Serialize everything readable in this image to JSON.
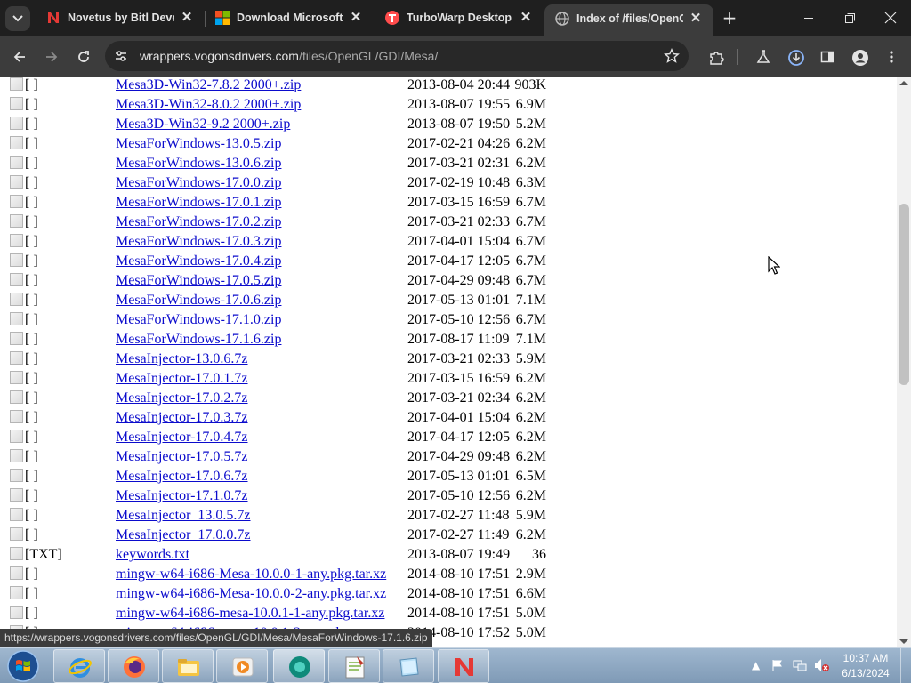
{
  "browser": {
    "tabs": [
      {
        "title": "Novetus by Bitl Developer",
        "favicon": "novetus-n-icon",
        "active": false
      },
      {
        "title": "Download Microsoft Visual C++",
        "favicon": "microsoft-logo-icon",
        "active": false
      },
      {
        "title": "TurboWarp Desktop - Scratch",
        "favicon": "turbowarp-icon",
        "active": false
      },
      {
        "title": "Index of /files/OpenGL/GDI/Mesa",
        "favicon": "globe-icon",
        "active": true
      }
    ],
    "address": {
      "host": "wrappers.vogonsdrivers.com",
      "path": "/files/OpenGL/GDI/Mesa/"
    }
  },
  "listing": {
    "rows": [
      {
        "icon_alt": "[ ]",
        "name": "Mesa3D-Win32-7.8.2 2000+.zip",
        "date": "2013-08-04 20:44",
        "size": "903K"
      },
      {
        "icon_alt": "[ ]",
        "name": "Mesa3D-Win32-8.0.2 2000+.zip",
        "date": "2013-08-07 19:55",
        "size": "6.9M"
      },
      {
        "icon_alt": "[ ]",
        "name": "Mesa3D-Win32-9.2 2000+.zip",
        "date": "2013-08-07 19:50",
        "size": "5.2M"
      },
      {
        "icon_alt": "[ ]",
        "name": "MesaForWindows-13.0.5.zip",
        "date": "2017-02-21 04:26",
        "size": "6.2M"
      },
      {
        "icon_alt": "[ ]",
        "name": "MesaForWindows-13.0.6.zip",
        "date": "2017-03-21 02:31",
        "size": "6.2M"
      },
      {
        "icon_alt": "[ ]",
        "name": "MesaForWindows-17.0.0.zip",
        "date": "2017-02-19 10:48",
        "size": "6.3M"
      },
      {
        "icon_alt": "[ ]",
        "name": "MesaForWindows-17.0.1.zip",
        "date": "2017-03-15 16:59",
        "size": "6.7M"
      },
      {
        "icon_alt": "[ ]",
        "name": "MesaForWindows-17.0.2.zip",
        "date": "2017-03-21 02:33",
        "size": "6.7M"
      },
      {
        "icon_alt": "[ ]",
        "name": "MesaForWindows-17.0.3.zip",
        "date": "2017-04-01 15:04",
        "size": "6.7M"
      },
      {
        "icon_alt": "[ ]",
        "name": "MesaForWindows-17.0.4.zip",
        "date": "2017-04-17 12:05",
        "size": "6.7M"
      },
      {
        "icon_alt": "[ ]",
        "name": "MesaForWindows-17.0.5.zip",
        "date": "2017-04-29 09:48",
        "size": "6.7M"
      },
      {
        "icon_alt": "[ ]",
        "name": "MesaForWindows-17.0.6.zip",
        "date": "2017-05-13 01:01",
        "size": "7.1M"
      },
      {
        "icon_alt": "[ ]",
        "name": "MesaForWindows-17.1.0.zip",
        "date": "2017-05-10 12:56",
        "size": "6.7M"
      },
      {
        "icon_alt": "[ ]",
        "name": "MesaForWindows-17.1.6.zip",
        "date": "2017-08-17 11:09",
        "size": "7.1M"
      },
      {
        "icon_alt": "[ ]",
        "name": "MesaInjector-13.0.6.7z",
        "date": "2017-03-21 02:33",
        "size": "5.9M"
      },
      {
        "icon_alt": "[ ]",
        "name": "MesaInjector-17.0.1.7z",
        "date": "2017-03-15 16:59",
        "size": "6.2M"
      },
      {
        "icon_alt": "[ ]",
        "name": "MesaInjector-17.0.2.7z",
        "date": "2017-03-21 02:34",
        "size": "6.2M"
      },
      {
        "icon_alt": "[ ]",
        "name": "MesaInjector-17.0.3.7z",
        "date": "2017-04-01 15:04",
        "size": "6.2M"
      },
      {
        "icon_alt": "[ ]",
        "name": "MesaInjector-17.0.4.7z",
        "date": "2017-04-17 12:05",
        "size": "6.2M"
      },
      {
        "icon_alt": "[ ]",
        "name": "MesaInjector-17.0.5.7z",
        "date": "2017-04-29 09:48",
        "size": "6.2M"
      },
      {
        "icon_alt": "[ ]",
        "name": "MesaInjector-17.0.6.7z",
        "date": "2017-05-13 01:01",
        "size": "6.5M"
      },
      {
        "icon_alt": "[ ]",
        "name": "MesaInjector-17.1.0.7z",
        "date": "2017-05-10 12:56",
        "size": "6.2M"
      },
      {
        "icon_alt": "[ ]",
        "name": "MesaInjector_13.0.5.7z",
        "date": "2017-02-27 11:48",
        "size": "5.9M"
      },
      {
        "icon_alt": "[ ]",
        "name": "MesaInjector_17.0.0.7z",
        "date": "2017-02-27 11:49",
        "size": "6.2M"
      },
      {
        "icon_alt": "[TXT]",
        "name": "keywords.txt",
        "date": "2013-08-07 19:49",
        "size": "36"
      },
      {
        "icon_alt": "[ ]",
        "name": "mingw-w64-i686-Mesa-10.0.0-1-any.pkg.tar.xz",
        "date": "2014-08-10 17:51",
        "size": "2.9M"
      },
      {
        "icon_alt": "[ ]",
        "name": "mingw-w64-i686-Mesa-10.0.0-2-any.pkg.tar.xz",
        "date": "2014-08-10 17:51",
        "size": "6.6M"
      },
      {
        "icon_alt": "[ ]",
        "name": "mingw-w64-i686-mesa-10.0.1-1-any.pkg.tar.xz",
        "date": "2014-08-10 17:51",
        "size": "5.0M"
      },
      {
        "icon_alt": "[ ]",
        "name": "mingw-w64-i686-mesa-10.0.1-2-any.pkg.tar.xz",
        "date": "2014-08-10 17:52",
        "size": "5.0M"
      }
    ]
  },
  "status_bubble": "https://wrappers.vogonsdrivers.com/files/OpenGL/GDI/Mesa/MesaForWindows-17.1.6.zip",
  "taskbar": {
    "apps": [
      "internet-explorer",
      "firefox",
      "file-explorer",
      "media-player",
      "unknown-app",
      "notepad-plus-plus",
      "unknown-window",
      "novetus"
    ],
    "clock": {
      "time": "10:37 AM",
      "date": "6/13/2024"
    }
  },
  "colors": {
    "tabstrip": "#1f1f1f",
    "toolbar": "#3c3c3c",
    "omnibox": "#282828",
    "link": "#0b0bcc",
    "taskbar": "#8fa9c4"
  }
}
